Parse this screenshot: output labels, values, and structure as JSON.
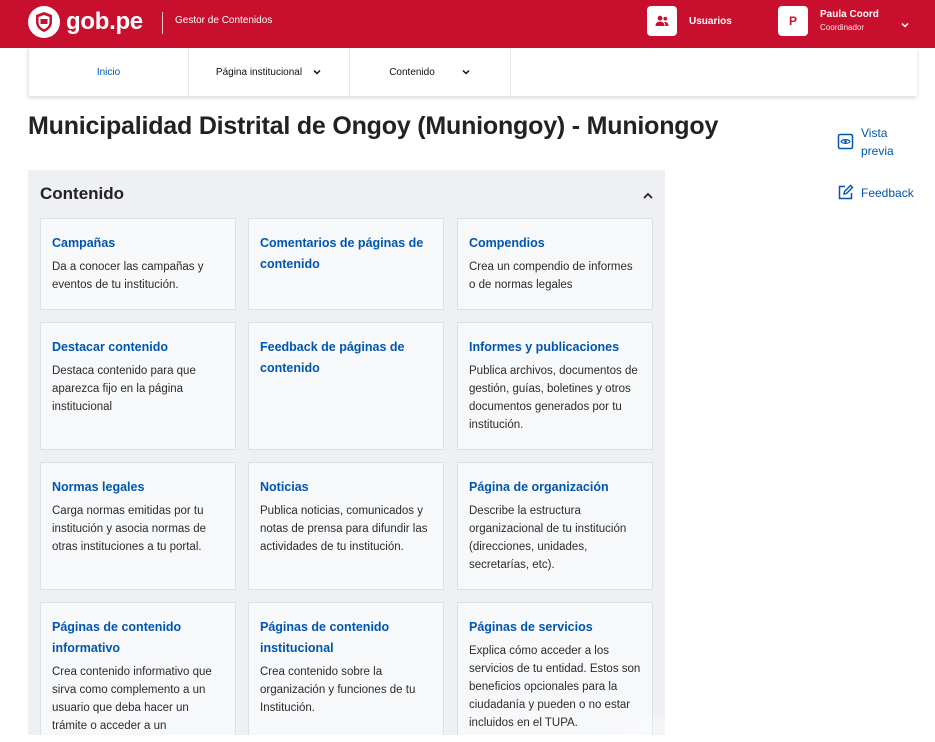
{
  "header": {
    "logo_text": "gob.pe",
    "app_name": "Gestor de Contenidos",
    "users_label": "Usuarios",
    "user": {
      "avatar_initial": "P",
      "name": "Paula Coord",
      "role": "Coordinador"
    }
  },
  "nav": {
    "home": "Inicio",
    "institutional_page": "Página institucional",
    "content": "Contenido"
  },
  "page_title": "Municipalidad Distrital de Ongoy (Muniongoy) - Muniongoy",
  "side_actions": {
    "preview": "Vista previa",
    "feedback": "Feedback"
  },
  "panel": {
    "heading": "Contenido",
    "cards": [
      {
        "title": "Campañas",
        "desc": "Da a conocer las campañas y eventos de tu institución."
      },
      {
        "title": "Comentarios de páginas de contenido",
        "desc": ""
      },
      {
        "title": "Compendios",
        "desc": "Crea un compendio de informes o de normas legales"
      },
      {
        "title": "Destacar contenido",
        "desc": "Destaca contenido para que aparezca fijo en la página institucional"
      },
      {
        "title": "Feedback de páginas de contenido",
        "desc": ""
      },
      {
        "title": "Informes y publicaciones",
        "desc": "Publica archivos, documentos de gestión, guías, boletines y otros documentos generados por tu institución."
      },
      {
        "title": "Normas legales",
        "desc": "Carga normas emitidas por tu institución y asocia normas de otras instituciones a tu portal."
      },
      {
        "title": "Noticias",
        "desc": "Publica noticias, comunicados y notas de prensa para difundir las actividades de tu institución."
      },
      {
        "title": "Página de organización",
        "desc": "Describe la estructura organizacional de tu institución (direcciones, unidades, secretarías, etc)."
      },
      {
        "title": "Páginas de contenido informativo",
        "desc": "Crea contenido informativo que sirva como complemento a un usuario que deba hacer un trámite o acceder a un"
      },
      {
        "title": "Páginas de contenido institucional",
        "desc": "Crea contenido sobre la organización y funciones de tu Institución."
      },
      {
        "title": "Páginas de servicios",
        "desc": "Explica cómo acceder a los servicios de tu entidad. Estos son beneficios opcionales para la ciudadanía y pueden o no estar incluidos en el TUPA."
      }
    ]
  },
  "colors": {
    "brand_red": "#c8102e",
    "link_blue": "#0056ac",
    "panel_bg": "#eef0f3"
  },
  "icons": [
    "peru-shield-icon",
    "users-icon",
    "chevron-down-icon",
    "eye-icon",
    "edit-icon",
    "chevron-up-icon"
  ]
}
